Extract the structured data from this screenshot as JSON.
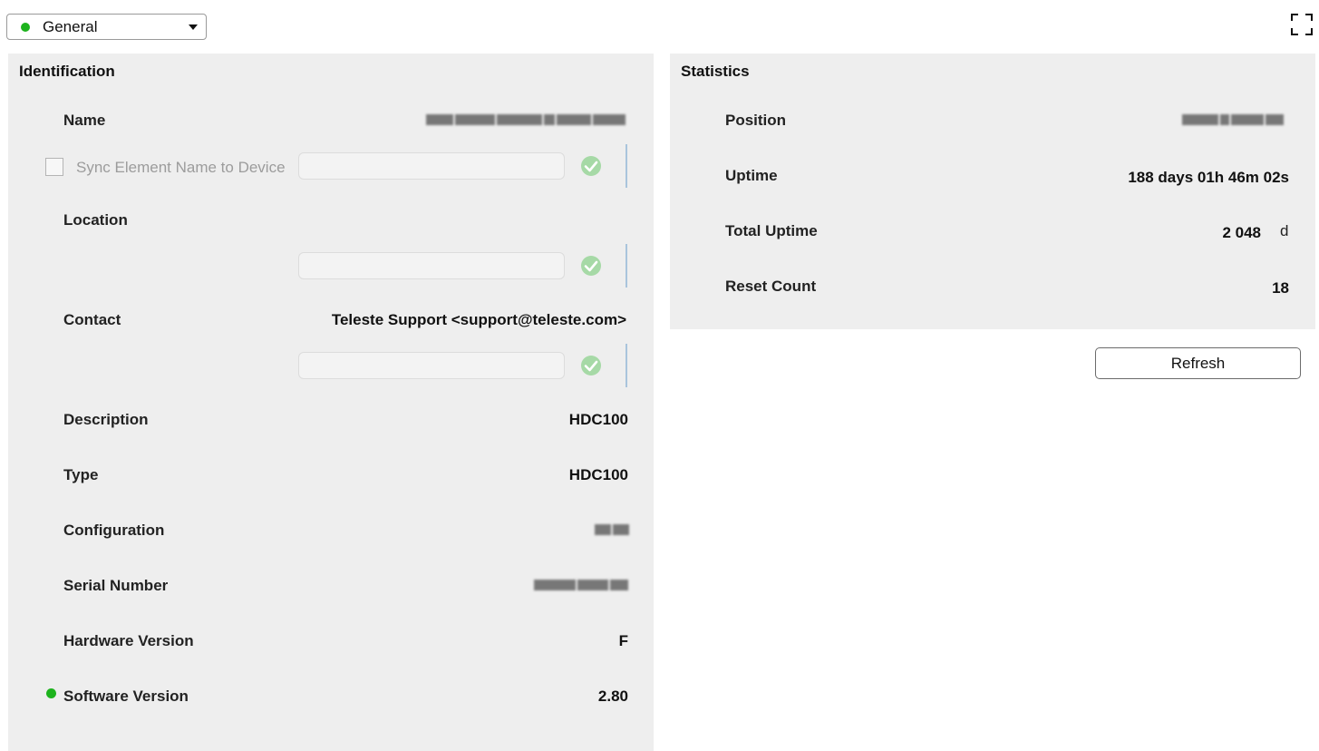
{
  "view_selector": {
    "label": "General",
    "status_color": "#1db31d"
  },
  "identification": {
    "title": "Identification",
    "name": {
      "label": "Name"
    },
    "sync": {
      "label": "Sync Element Name to Device",
      "checked": false
    },
    "location": {
      "label": "Location",
      "value": ""
    },
    "contact": {
      "label": "Contact",
      "value": "Teleste Support <support@teleste.com>"
    },
    "description": {
      "label": "Description",
      "value": "HDC100"
    },
    "type": {
      "label": "Type",
      "value": "HDC100"
    },
    "configuration": {
      "label": "Configuration"
    },
    "serial_number": {
      "label": "Serial Number"
    },
    "hardware_version": {
      "label": "Hardware Version",
      "value": "F"
    },
    "software_version": {
      "label": "Software Version",
      "value": "2.80",
      "status_color": "#1db31d"
    }
  },
  "statistics": {
    "title": "Statistics",
    "position": {
      "label": "Position"
    },
    "uptime": {
      "label": "Uptime",
      "value": "188 days 01h 46m 02s"
    },
    "total_uptime": {
      "label": "Total Uptime",
      "value": "2 048",
      "unit": "d"
    },
    "reset_count": {
      "label": "Reset Count",
      "value": "18"
    }
  },
  "actions": {
    "refresh_label": "Refresh"
  },
  "colors": {
    "accent_ok": "#1db31d",
    "panel_bg": "#eeeeee"
  }
}
